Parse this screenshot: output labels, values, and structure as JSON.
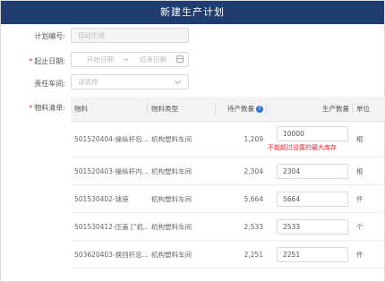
{
  "dialog": {
    "title": "新建生产计划"
  },
  "form": {
    "plan_no": {
      "label": "计划编号:",
      "placeholder": "自动生成"
    },
    "date": {
      "label": "起止日期:",
      "start_placeholder": "开始日期",
      "separator": "→",
      "end_placeholder": "结束日期"
    },
    "workshop": {
      "label": "责任车间:",
      "placeholder": "请选择"
    },
    "materials": {
      "label": "物料清单:"
    }
  },
  "table": {
    "headers": {
      "material": "物料",
      "type": "物料类型",
      "pending": "待产数量",
      "produce": "生产数量",
      "unit": "单位"
    },
    "rows": [
      {
        "material": "501520404-操纵杆包...",
        "type": "机构塑料车间",
        "pending": "1,209",
        "qty": "10000",
        "unit": "根",
        "error": "不能超过设置的最大库存"
      },
      {
        "material": "501520403-操纵杆内...",
        "type": "机构塑料车间",
        "pending": "2,304",
        "qty": "2304",
        "unit": "根"
      },
      {
        "material": "501530402-球座",
        "type": "机构塑料车间",
        "pending": "5,664",
        "qty": "5664",
        "unit": "件"
      },
      {
        "material": "501530412-压盖 [\"机...",
        "type": "机构塑料车间",
        "pending": "2,533",
        "qty": "2533",
        "unit": "个"
      },
      {
        "material": "503620403-换挡杆总...",
        "type": "机构塑料车间",
        "pending": "2,251",
        "qty": "2251",
        "unit": "件"
      }
    ]
  },
  "colors": {
    "header_bg": "#1f3d6e",
    "required": "#f5222d",
    "error": "#f5222d",
    "help_icon": "#2f77d1"
  },
  "icons": {
    "date": "calendar-icon",
    "select": "chevron-down-icon",
    "help": "question-circle-icon"
  }
}
